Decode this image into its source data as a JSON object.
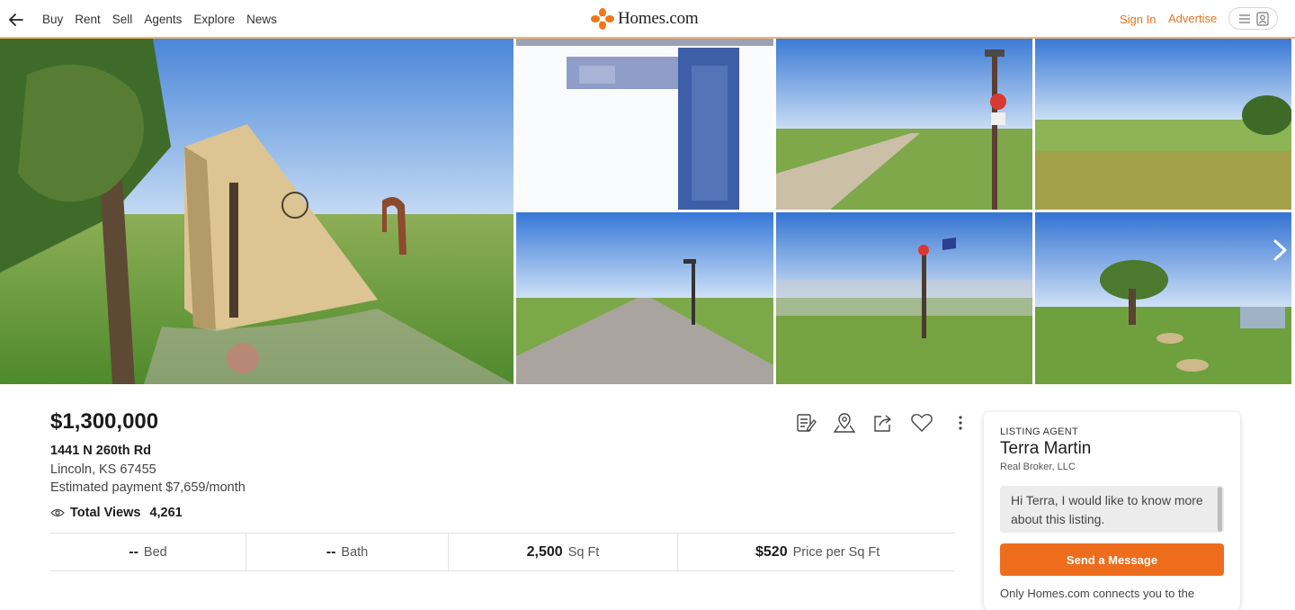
{
  "header": {
    "nav": [
      "Buy",
      "Rent",
      "Sell",
      "Agents",
      "Explore",
      "News"
    ],
    "logo_text": "Homes.com",
    "sign_in": "Sign In",
    "advertise": "Advertise",
    "icons": {
      "back": "arrow-left-icon",
      "menu": "hamburger-icon",
      "account": "account-icon"
    },
    "brand_color": "#e8731e"
  },
  "gallery": {
    "photos": [
      "bunker-entrance-photo",
      "floor-plan-scan-photo",
      "gravel-road-sign-photo",
      "prairie-field-photo",
      "access-road-photo",
      "fenced-compound-photo",
      "yard-with-shed-photo"
    ]
  },
  "listing": {
    "price": "$1,300,000",
    "address_line1": "1441 N 260th Rd",
    "address_line2": "Lincoln, KS 67455",
    "estimated_payment": "Estimated payment $7,659/month",
    "views_label": "Total Views",
    "views_count": "4,261"
  },
  "actions": [
    "notes-icon",
    "map-pin-icon",
    "share-icon",
    "heart-icon",
    "more-vertical-icon"
  ],
  "stats": [
    {
      "value": "--",
      "label": "Bed"
    },
    {
      "value": "--",
      "label": "Bath"
    },
    {
      "value": "2,500",
      "label": "Sq Ft"
    },
    {
      "value": "$520",
      "label": "Price per Sq Ft"
    }
  ],
  "agent": {
    "eyebrow": "LISTING AGENT",
    "name": "Terra Martin",
    "broker": "Real Broker, LLC",
    "message": "Hi Terra, I would like to know more about this listing.",
    "send_label": "Send a Message",
    "disclaimer": "Only Homes.com connects you to the"
  }
}
